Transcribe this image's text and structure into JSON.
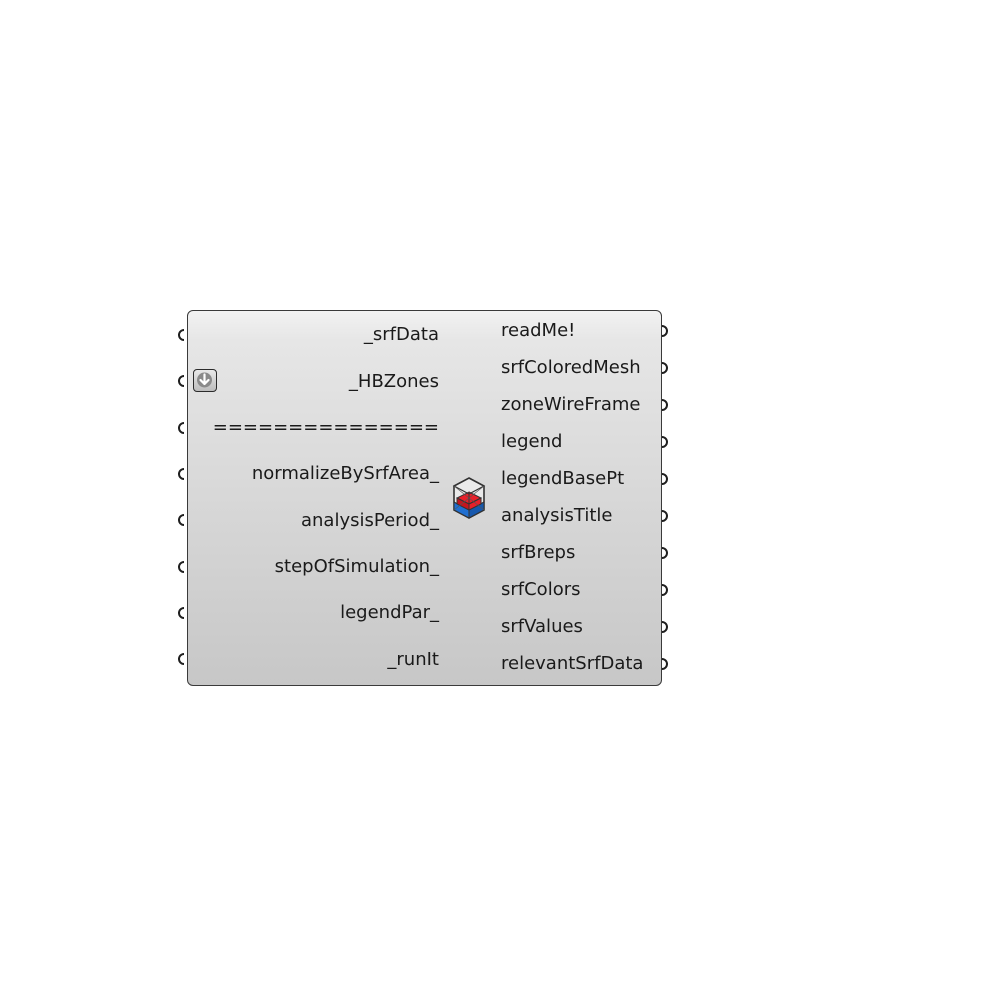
{
  "component": {
    "inputs": [
      "_srfData",
      "_HBZones",
      "===============",
      "normalizeBySrfArea_",
      "analysisPeriod_",
      "stepOfSimulation_",
      "legendPar_",
      "_runIt"
    ],
    "outputs": [
      "readMe!",
      "srfColoredMesh",
      "zoneWireFrame",
      "legend",
      "legendBasePt",
      "analysisTitle",
      "srfBreps",
      "srfColors",
      "srfValues",
      "relevantSrfData"
    ],
    "icon": "honeybee-zone-cube-icon",
    "flatten_indicator_icon": "flatten-arrow-icon",
    "colors": {
      "body": "#d6d6d6",
      "border": "#3a3a3a",
      "icon_red": "#e8202a",
      "icon_blue": "#1f6fd1"
    }
  }
}
